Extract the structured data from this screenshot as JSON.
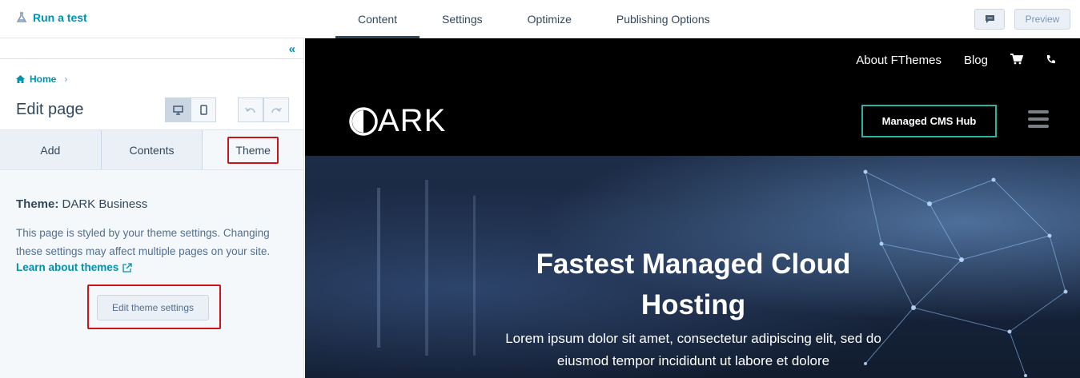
{
  "topbar": {
    "run_test": "Run a test",
    "tabs": [
      "Content",
      "Settings",
      "Optimize",
      "Publishing Options"
    ],
    "preview": "Preview"
  },
  "sidebar": {
    "breadcrumb": "Home",
    "title": "Edit page",
    "tabs": [
      "Add",
      "Contents",
      "Theme"
    ],
    "theme_label": "Theme:",
    "theme_name": "DARK Business",
    "description": "This page is styled by your theme settings. Changing these settings may affect multiple pages on your site.",
    "learn_link": "Learn about themes",
    "edit_button": "Edit theme settings"
  },
  "site": {
    "util_links": [
      "About FThemes",
      "Blog"
    ],
    "logo_text": "ARK",
    "cta": "Managed CMS Hub",
    "hero_title": "Fastest Managed Cloud Hosting",
    "hero_sub": "Lorem ipsum dolor sit amet, consectetur adipiscing elit, sed do eiusmod tempor incididunt ut labore et dolore"
  },
  "colors": {
    "accent": "#0091ae",
    "highlight": "#d0121b",
    "cta_border": "#2bb3a2"
  },
  "icons": [
    "flask-icon",
    "comment-icon",
    "collapse-icon",
    "home-icon",
    "desktop-icon",
    "mobile-icon",
    "undo-icon",
    "redo-icon",
    "external-link-icon",
    "cart-icon",
    "phone-icon",
    "hamburger-icon"
  ]
}
